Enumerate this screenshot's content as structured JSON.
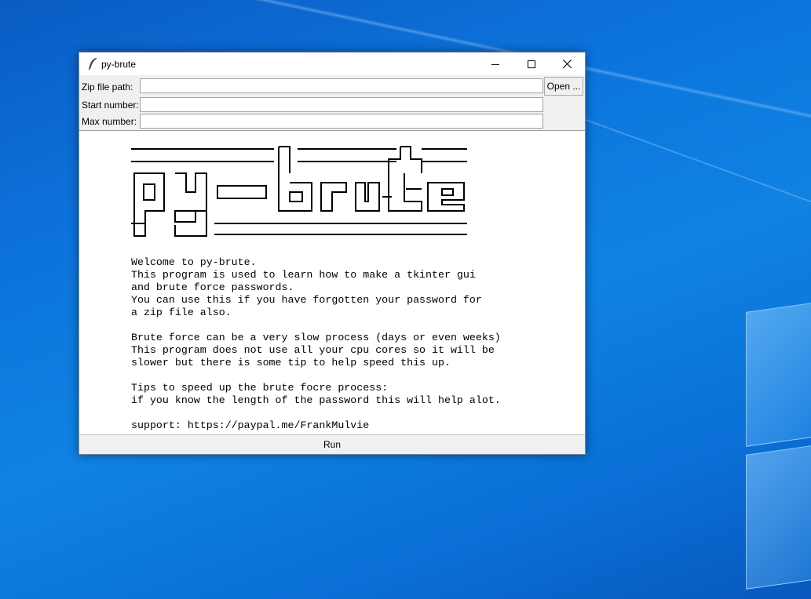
{
  "window": {
    "title": "py-brute",
    "icon": "feather-icon",
    "controls": [
      "minimize-icon",
      "maximize-icon",
      "close-icon"
    ]
  },
  "form": {
    "zip_label": "Zip file path:",
    "zip_value": "",
    "open_button": "Open ...",
    "start_label": "Start number:",
    "start_value": "",
    "max_label": "Max number:",
    "max_value": ""
  },
  "banner": {
    "art": "py-brute"
  },
  "info_text": "Welcome to py-brute.\nThis program is used to learn how to make a tkinter gui\nand brute force passwords.\nYou can use this if you have forgotten your password for\na zip file also.\n\nBrute force can be a very slow process (days or even weeks)\nThis program does not use all your cpu cores so it will be\nslower but there is some tip to help speed this up.\n\nTips to speed up the brute focre process:\nif you know the length of the password this will help alot.\n\nsupport: https://paypal.me/FrankMulvie",
  "run_button": "Run",
  "colors": {
    "desktop": "#0c74dc",
    "window_bg": "#f0f0f0",
    "text_bg": "#ffffff"
  }
}
